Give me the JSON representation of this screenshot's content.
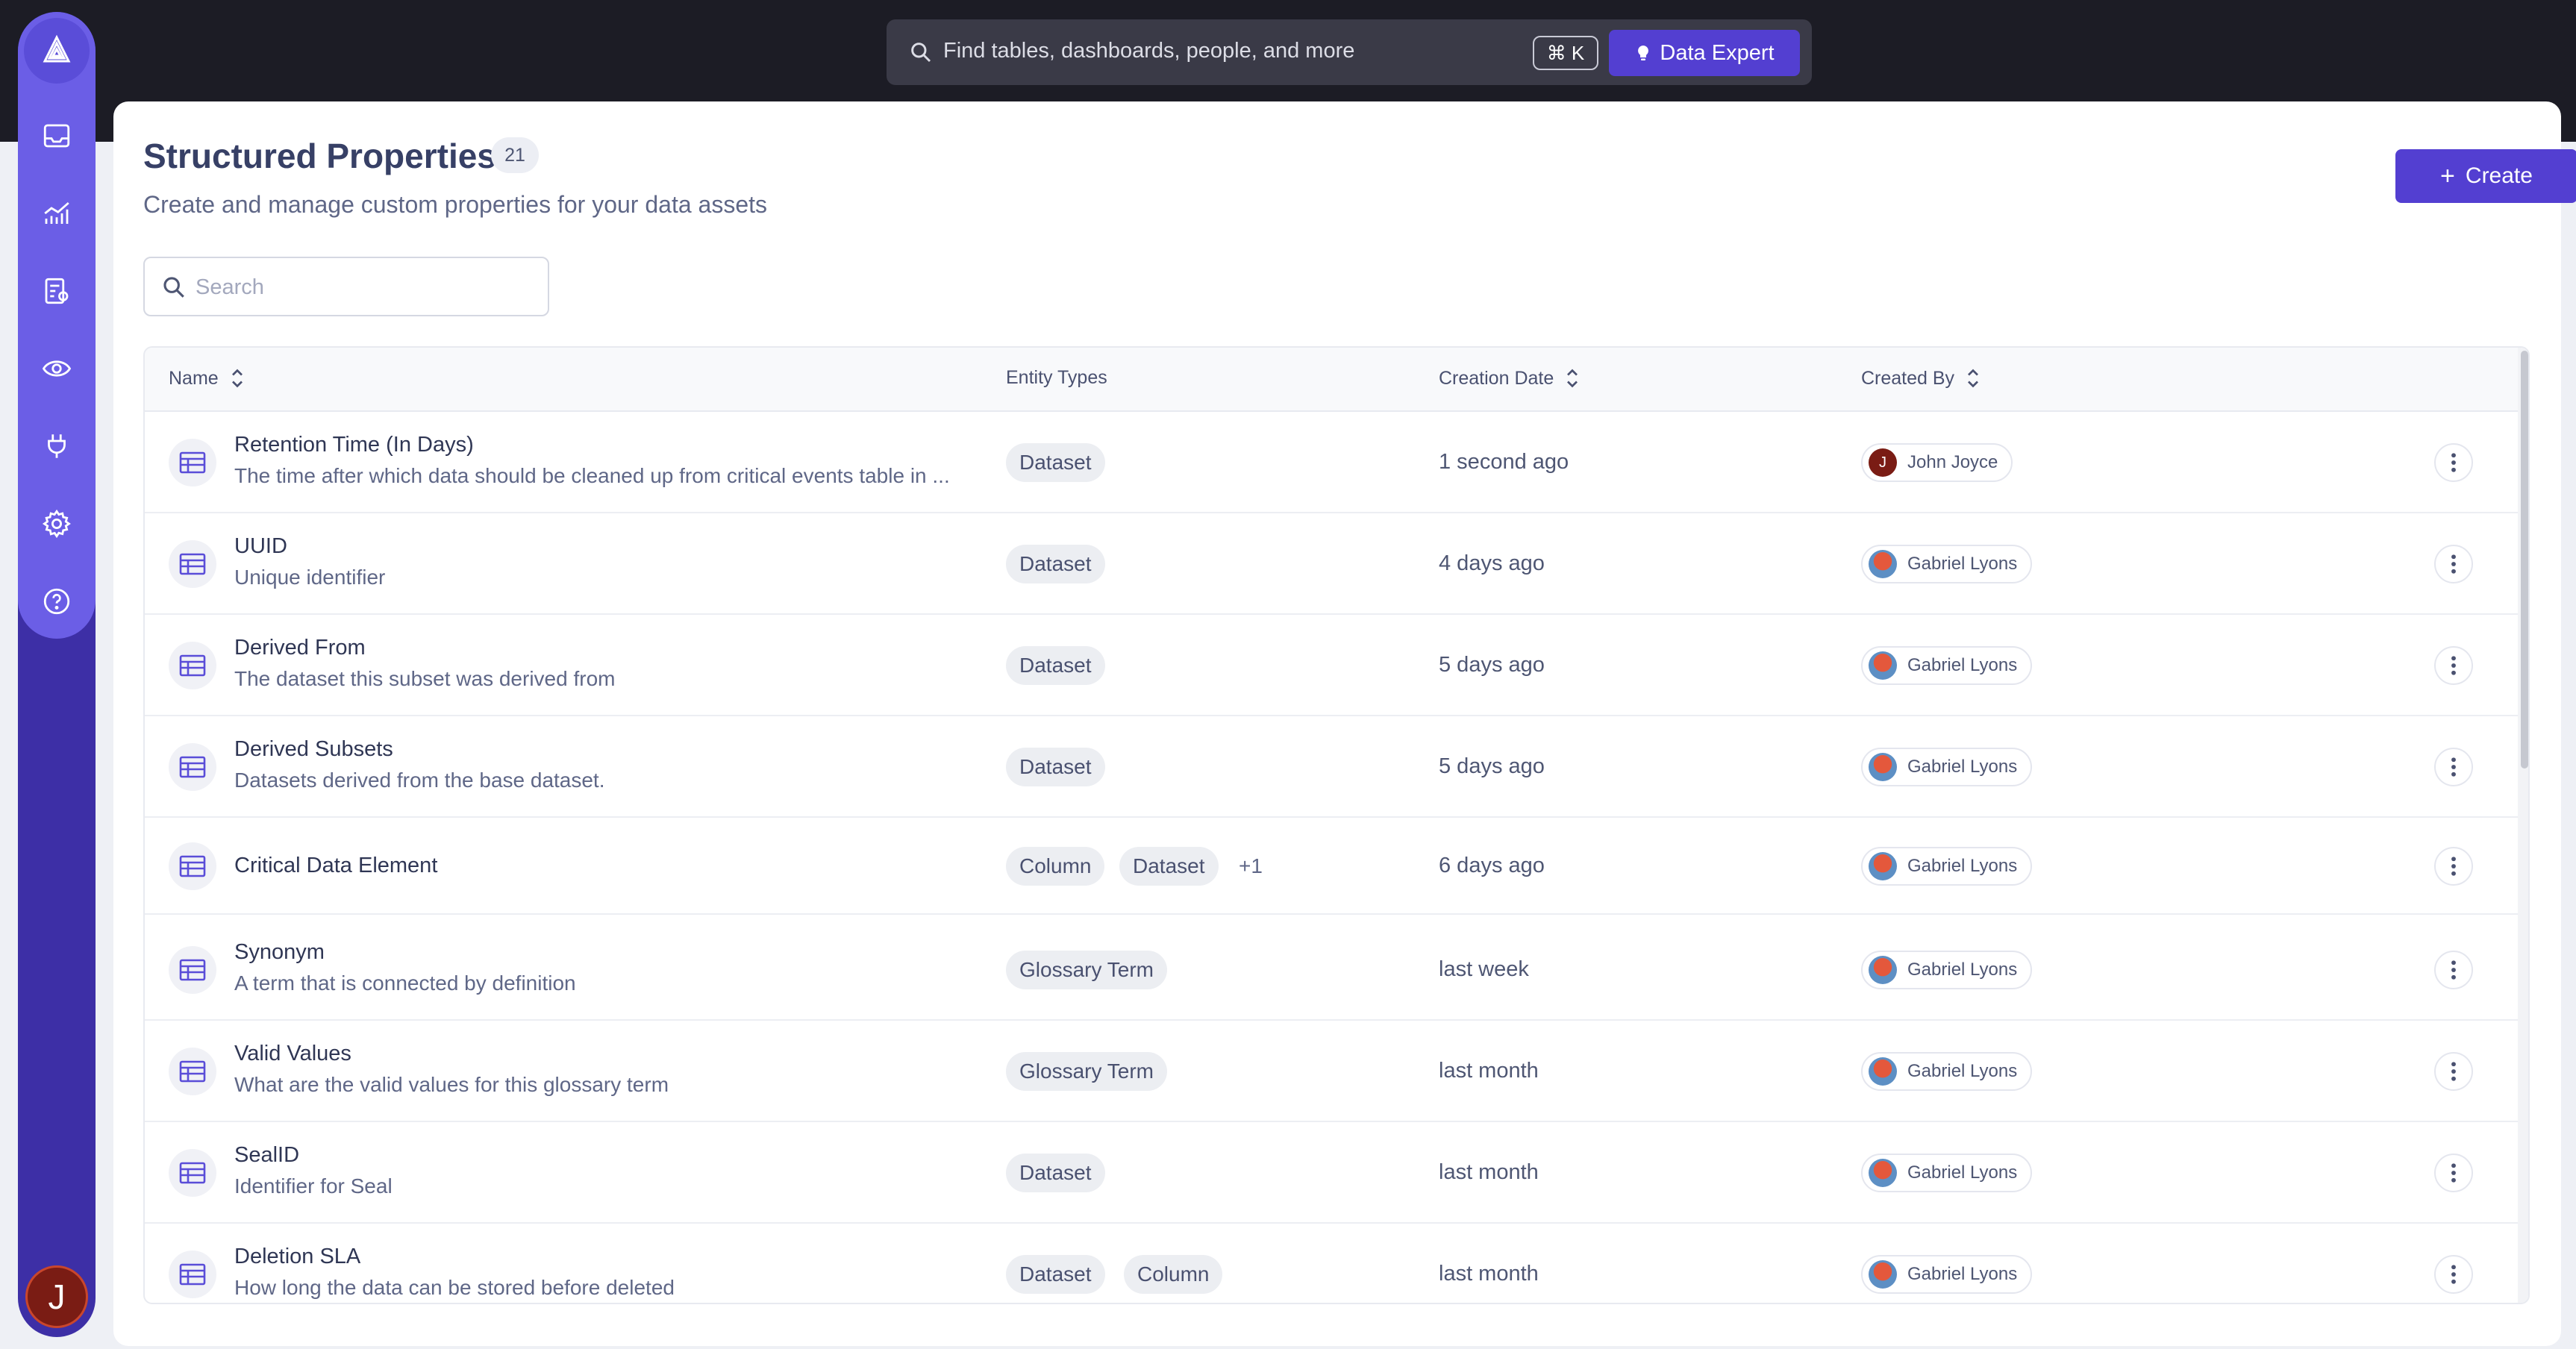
{
  "sidebar": {
    "logo_icon": "datahub-logo-icon",
    "items": [
      {
        "icon": "inbox-icon"
      },
      {
        "icon": "analytics-chart-icon"
      },
      {
        "icon": "governance-icon"
      },
      {
        "icon": "observe-eye-icon"
      },
      {
        "icon": "ingestion-plug-icon"
      },
      {
        "icon": "settings-gear-icon"
      },
      {
        "icon": "help-icon"
      }
    ],
    "user_initial": "J"
  },
  "topbar": {
    "search_placeholder": "Find tables, dashboards, people, and more",
    "shortcut": "⌘ K",
    "expert_label": "Data Expert"
  },
  "page": {
    "title": "Structured Properties",
    "count": "21",
    "subtitle": "Create and manage custom properties for your data assets",
    "create_label": "Create",
    "search_placeholder": "Search"
  },
  "table": {
    "columns": {
      "name": "Name",
      "entity_types": "Entity Types",
      "creation_date": "Creation Date",
      "created_by": "Created By"
    },
    "rows": [
      {
        "name": "Retention Time (In Days)",
        "description": "The time after which data should be cleaned up from critical events table in ...",
        "entity_types": [
          "Dataset"
        ],
        "more": "",
        "date": "1 second ago",
        "user": "John Joyce",
        "user_initial": "J"
      },
      {
        "name": "UUID",
        "description": "Unique identifier",
        "entity_types": [
          "Dataset"
        ],
        "more": "",
        "date": "4 days ago",
        "user": "Gabriel Lyons",
        "user_initial": ""
      },
      {
        "name": "Derived From",
        "description": "The dataset this subset was derived from",
        "entity_types": [
          "Dataset"
        ],
        "more": "",
        "date": "5 days ago",
        "user": "Gabriel Lyons",
        "user_initial": ""
      },
      {
        "name": "Derived Subsets",
        "description": "Datasets derived from the base dataset.",
        "entity_types": [
          "Dataset"
        ],
        "more": "",
        "date": "5 days ago",
        "user": "Gabriel Lyons",
        "user_initial": ""
      },
      {
        "name": "Critical Data Element",
        "description": "",
        "entity_types": [
          "Column",
          "Dataset"
        ],
        "more": "+1",
        "date": "6 days ago",
        "user": "Gabriel Lyons",
        "user_initial": ""
      },
      {
        "name": "Synonym",
        "description": "A term that is connected by definition",
        "entity_types": [
          "Glossary Term"
        ],
        "more": "",
        "date": "last week",
        "user": "Gabriel Lyons",
        "user_initial": ""
      },
      {
        "name": "Valid Values",
        "description": "What are the valid values for this glossary term",
        "entity_types": [
          "Glossary Term"
        ],
        "more": "",
        "date": "last month",
        "user": "Gabriel Lyons",
        "user_initial": ""
      },
      {
        "name": "SealID",
        "description": "Identifier for Seal",
        "entity_types": [
          "Dataset"
        ],
        "more": "",
        "date": "last month",
        "user": "Gabriel Lyons",
        "user_initial": ""
      },
      {
        "name": "Deletion SLA",
        "description": "How long the data can be stored before deleted",
        "entity_types": [
          "Dataset",
          "Column"
        ],
        "more": "",
        "date": "last month",
        "user": "Gabriel Lyons",
        "user_initial": ""
      }
    ]
  },
  "colors": {
    "brand": "#533fd1",
    "sidebar": "#6b5ee6",
    "topbar_bg": "#1c1c25"
  }
}
